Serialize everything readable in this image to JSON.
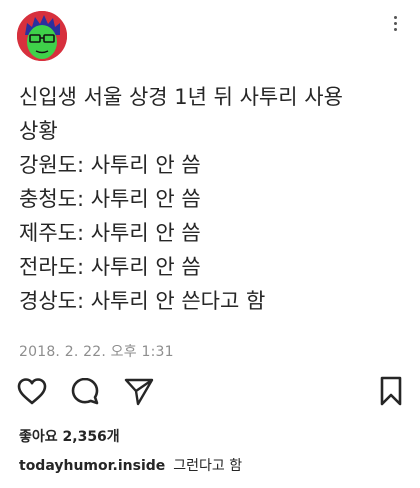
{
  "post": {
    "lines": [
      "신입생 서울 상경 1년 뒤 사투리 사용",
      "상황",
      "강원도: 사투리 안 씀",
      "충청도: 사투리 안 씀",
      "제주도: 사투리 안 씀",
      "전라도: 사투리 안 씀",
      "경상도: 사투리 안 쓴다고 함"
    ],
    "timestamp": "2018. 2. 22. 오후 1:31"
  },
  "engagement": {
    "likes": "좋아요 2,356개"
  },
  "caption": {
    "username": "todayhumor.inside",
    "text": "그런다고 함"
  },
  "icons": {
    "like": "heart-icon",
    "comment": "comment-icon",
    "share": "share-icon",
    "save": "bookmark-icon",
    "more": "more-vertical-icon"
  },
  "colors": {
    "avatar_bg": "#d7303d",
    "avatar_face": "#3fd14a",
    "text": "#262626",
    "muted": "#8e8e8e"
  }
}
